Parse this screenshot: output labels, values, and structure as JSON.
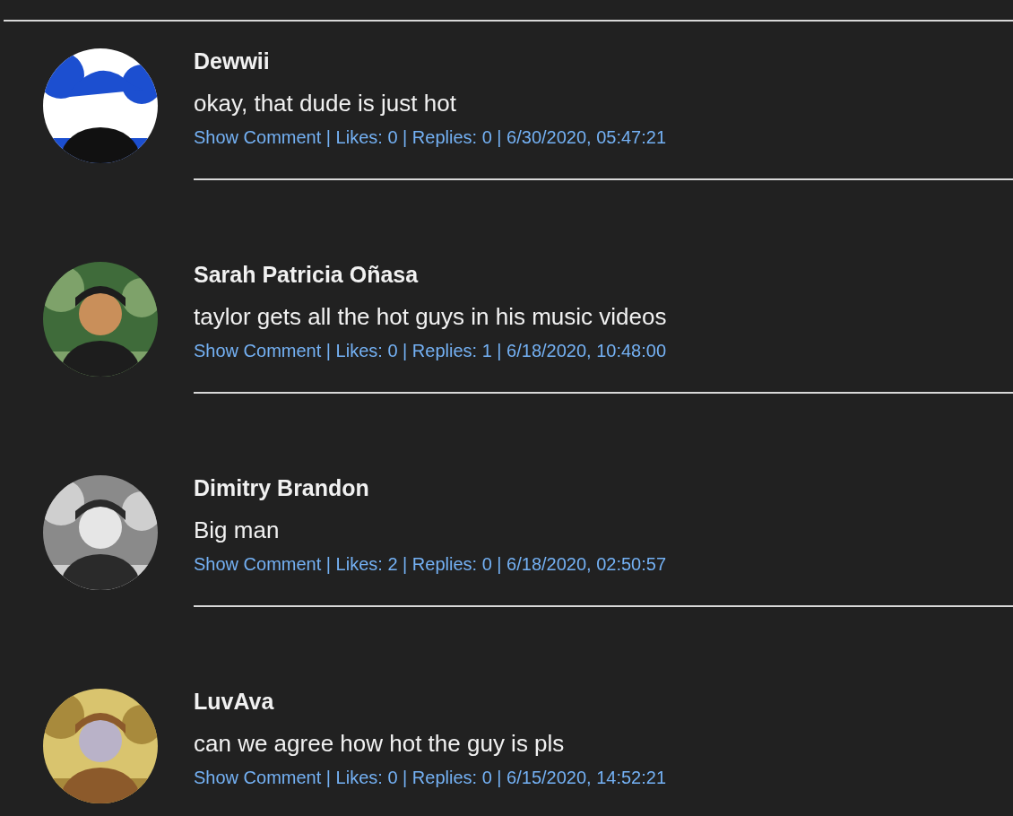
{
  "comments": [
    {
      "author": "Dewwii",
      "text": "okay, that dude is just hot",
      "link": "Show Comment",
      "meta": "| Likes: 0 | Replies: 0 | 6/30/2020, 05:47:21"
    },
    {
      "author": "Sarah Patricia Oñasa",
      "text": "taylor gets all the hot guys in his music videos",
      "link": "Show Comment",
      "meta": "| Likes: 0 | Replies: 1 | 6/18/2020, 10:48:00"
    },
    {
      "author": "Dimitry Brandon",
      "text": "Big man",
      "link": "Show Comment",
      "meta": "| Likes: 2 | Replies: 0 | 6/18/2020, 02:50:57"
    },
    {
      "author": "LuvAva",
      "text": "can we agree how hot the guy is pls",
      "link": "Show Comment",
      "meta": "| Likes: 0 | Replies: 0 | 6/15/2020, 14:52:21"
    }
  ]
}
